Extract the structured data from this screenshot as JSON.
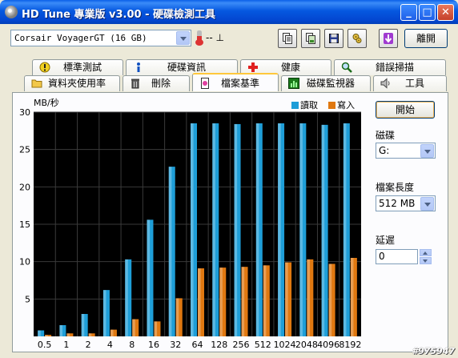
{
  "window": {
    "title": "HD Tune 專業版 v3.00 - 硬碟檢測工具",
    "minimize": "_",
    "maximize": "□",
    "close": "✕"
  },
  "toolbar": {
    "drive": "Corsair VoyagerGT (16 GB)",
    "temperature": "-- ⊥",
    "exit_label": "離開"
  },
  "tabs_top": [
    {
      "label": "標準測試",
      "icon": "exclamation-icon"
    },
    {
      "label": "硬碟資訊",
      "icon": "info-icon"
    },
    {
      "label": "健康",
      "icon": "health-cross-icon"
    },
    {
      "label": "錯誤掃描",
      "icon": "magnifier-icon"
    }
  ],
  "tabs_bottom": [
    {
      "label": "資料夾使用率",
      "icon": "folder-icon"
    },
    {
      "label": "刪除",
      "icon": "trash-icon"
    },
    {
      "label": "檔案基準",
      "icon": "file-benchmark-icon",
      "active": true
    },
    {
      "label": "磁碟監視器",
      "icon": "monitor-icon"
    },
    {
      "label": "工具",
      "icon": "speaker-icon"
    }
  ],
  "controls": {
    "start_label": "開始",
    "drive_label": "磁碟",
    "drive_value": "G:",
    "file_length_label": "檔案長度",
    "file_length_value": "512 MB",
    "delay_label": "延遲",
    "delay_value": "0"
  },
  "watermark": "#975947",
  "colors": {
    "read": "#1E9ED8",
    "write": "#E07810",
    "plot_bg": "#000000",
    "grid": "#3A3A3A"
  },
  "chart_data": {
    "type": "bar",
    "ylabel": "MB/秒",
    "ylim": [
      0,
      30
    ],
    "yticks": [
      5,
      10,
      15,
      20,
      25,
      30
    ],
    "categories": [
      "0.5",
      "1",
      "2",
      "4",
      "8",
      "16",
      "32",
      "64",
      "128",
      "256",
      "512",
      "1024",
      "2048",
      "4096",
      "8192"
    ],
    "series": [
      {
        "name": "讀取",
        "color": "#1E9ED8",
        "values": [
          0.8,
          1.5,
          3.0,
          6.2,
          10.3,
          15.6,
          22.7,
          28.5,
          28.5,
          28.4,
          28.5,
          28.5,
          28.5,
          28.3,
          28.5
        ]
      },
      {
        "name": "寫入",
        "color": "#E07810",
        "values": [
          0.2,
          0.4,
          0.4,
          0.9,
          2.3,
          2.0,
          5.1,
          9.1,
          9.2,
          9.3,
          9.5,
          9.9,
          10.3,
          9.7,
          10.5
        ]
      }
    ],
    "legend": "top-right",
    "grid": true
  }
}
